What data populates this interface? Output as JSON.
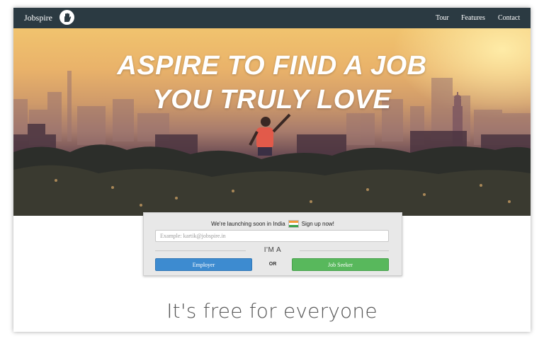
{
  "navbar": {
    "brand": "Jobspire",
    "logo_icon": "hand-icon",
    "links": [
      "Tour",
      "Features",
      "Contact"
    ],
    "background": "#2b3a42"
  },
  "hero": {
    "headline_line1": "ASPIRE TO FIND A JOB",
    "headline_line2": "YOU TRULY LOVE"
  },
  "signup": {
    "launch_text": "We're launching soon in India",
    "signup_text": "Sign up now!",
    "flag_icon": "india-flag-icon",
    "email_placeholder": "Example: kartik@jobspire.in",
    "im_a": "I'M A",
    "employer_label": "Employer",
    "or_label": "OR",
    "job_seeker_label": "Job Seeker",
    "employer_color": "#3d8bd0",
    "job_seeker_color": "#58b85c"
  },
  "tagline": "It's free for everyone"
}
